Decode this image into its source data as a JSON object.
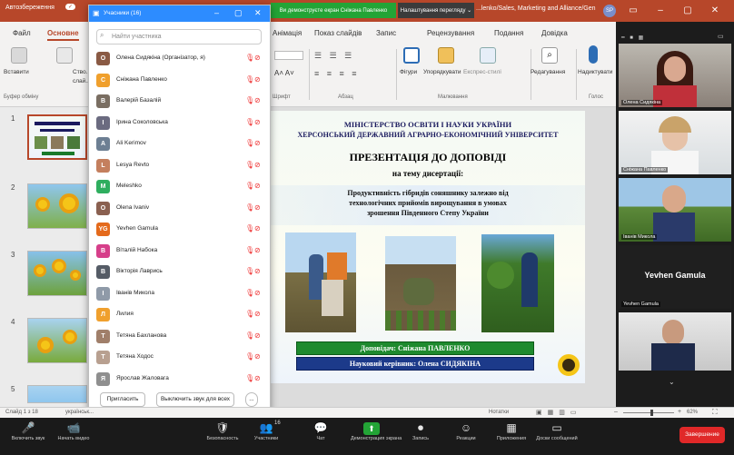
{
  "app": {
    "autosave_label": "Автозбереження",
    "autosave_state": "✓",
    "share_notice": "Ви демонструєте екран Сніжана Павленко",
    "view_options": "Налаштування перегляду ⌄",
    "doc_title": "...lenko/Sales, Marketing and Alliance/Gen",
    "user_initials": "SP",
    "ribbon_user": "АА"
  },
  "ribbon": {
    "tabs": [
      "Файл",
      "Основне",
      "...",
      "Анімація",
      "Показ слайдів",
      "Запис",
      "Рецензування",
      "Подання",
      "Довідка"
    ],
    "buttons": {
      "paste": "Вставити",
      "new_slide": "Ство...",
      "new_slide2": "слай...",
      "shapes": "Фігури",
      "arrange": "Упорядкувати",
      "quick_styles": "Експрес-стилі",
      "editing": "Редагування",
      "dictate": "Надиктувати"
    },
    "groups": [
      "Буфер обміну",
      "Шрифт",
      "Абзац",
      "Малювання",
      "Голос"
    ]
  },
  "participants": {
    "title": "Учасники (16)",
    "search_placeholder": "Найти участника",
    "list": [
      {
        "name": "Олена Сидякіна (Організатор, я)",
        "initial": "О",
        "color": "#8a5a44"
      },
      {
        "name": "Сніжана Павленко",
        "initial": "С",
        "color": "#f0a02d"
      },
      {
        "name": "Валерій Базалій",
        "initial": "В",
        "color": "#7a6e62"
      },
      {
        "name": "Ірина Соколовська",
        "initial": "І",
        "color": "#6b6b80"
      },
      {
        "name": "Ali Kerimov",
        "initial": "A",
        "color": "#6d7f93"
      },
      {
        "name": "Lesya Revto",
        "initial": "L",
        "color": "#c47f5e"
      },
      {
        "name": "Meleshko",
        "initial": "M",
        "color": "#2fae5f"
      },
      {
        "name": "Olena Ivaniv",
        "initial": "O",
        "color": "#8a6050"
      },
      {
        "name": "Yevhen Gamula",
        "initial": "YG",
        "color": "#e46a1c"
      },
      {
        "name": "Віталій Набока",
        "initial": "В",
        "color": "#d63f8a"
      },
      {
        "name": "Вікторія Лаврись",
        "initial": "В",
        "color": "#555c66"
      },
      {
        "name": "Іванів Микола",
        "initial": "І",
        "color": "#8f9aa8"
      },
      {
        "name": "Лилия",
        "initial": "Л",
        "color": "#f0a02d"
      },
      {
        "name": "Тетяна Бахланова",
        "initial": "Т",
        "color": "#a07f6a"
      },
      {
        "name": "Тетяна Ходос",
        "initial": "Т",
        "color": "#b8a090"
      },
      {
        "name": "Ярослав Жаловага",
        "initial": "Я",
        "color": "#8f8f8f"
      }
    ],
    "invite_button": "Пригласить",
    "mute_all_button": "Выключить звук для всех",
    "more_button": "..."
  },
  "slide": {
    "ministry": "МІНІСТЕРСТВО ОСВІТИ І НАУКИ УКРАЇНИ",
    "university": "ХЕРСОНСЬКИЙ ДЕРЖАВНИЙ АГРАРНО-ЕКОНОМІЧНИЙ УНІВЕРСИТЕТ",
    "heading": "ПРЕЗЕНТАЦІЯ ДО ДОПОВІДІ",
    "subheading": "на тему дисертації:",
    "topic_line1": "Продуктивність гібридів соняшнику залежно від",
    "topic_line2": "технологічних прийомів вирощування в умовах",
    "topic_line3": "зрошення Південного Степу України",
    "speaker": "Доповідач: Сніжана ПАВЛЕНКО",
    "advisor": "Науковий керівник: Олена СИДЯКІНА"
  },
  "thumbnail_numbers": [
    "1",
    "2",
    "3",
    "4",
    "5"
  ],
  "video_tiles": [
    {
      "name": "Олена Сидякіна"
    },
    {
      "name": "Сніжана Павленко"
    },
    {
      "name": "Іванів Микола"
    },
    {
      "name": "Yevhen Gamula",
      "display": "Yevhen Gamula"
    },
    {
      "name": ""
    }
  ],
  "statusbar": {
    "slide_count": "Слайд 1 з 18",
    "language": "українськ...",
    "notes": "Нотатки",
    "zoom": "62%"
  },
  "toolbar": {
    "items": [
      {
        "label": "Включить звук",
        "icon": "🎤"
      },
      {
        "label": "Начать видео",
        "icon": "📹"
      },
      {
        "label": "Безопасность",
        "icon": "🛡"
      },
      {
        "label": "Участники",
        "icon": "👥"
      },
      {
        "label": "Чат",
        "icon": "💬"
      },
      {
        "label": "Демонстрация экрана",
        "icon": "⬆"
      },
      {
        "label": "Запись",
        "icon": "⏺"
      },
      {
        "label": "Реакции",
        "icon": "☺"
      },
      {
        "label": "Приложения",
        "icon": "▦"
      },
      {
        "label": "Доски сообщений",
        "icon": "▭"
      }
    ],
    "participants_count": "16",
    "end_button": "Завершение"
  },
  "colors": {
    "ppt_accent": "#b7472a",
    "zoom_blue": "#2d8cff",
    "share_green": "#23a436",
    "end_red": "#e02828"
  }
}
